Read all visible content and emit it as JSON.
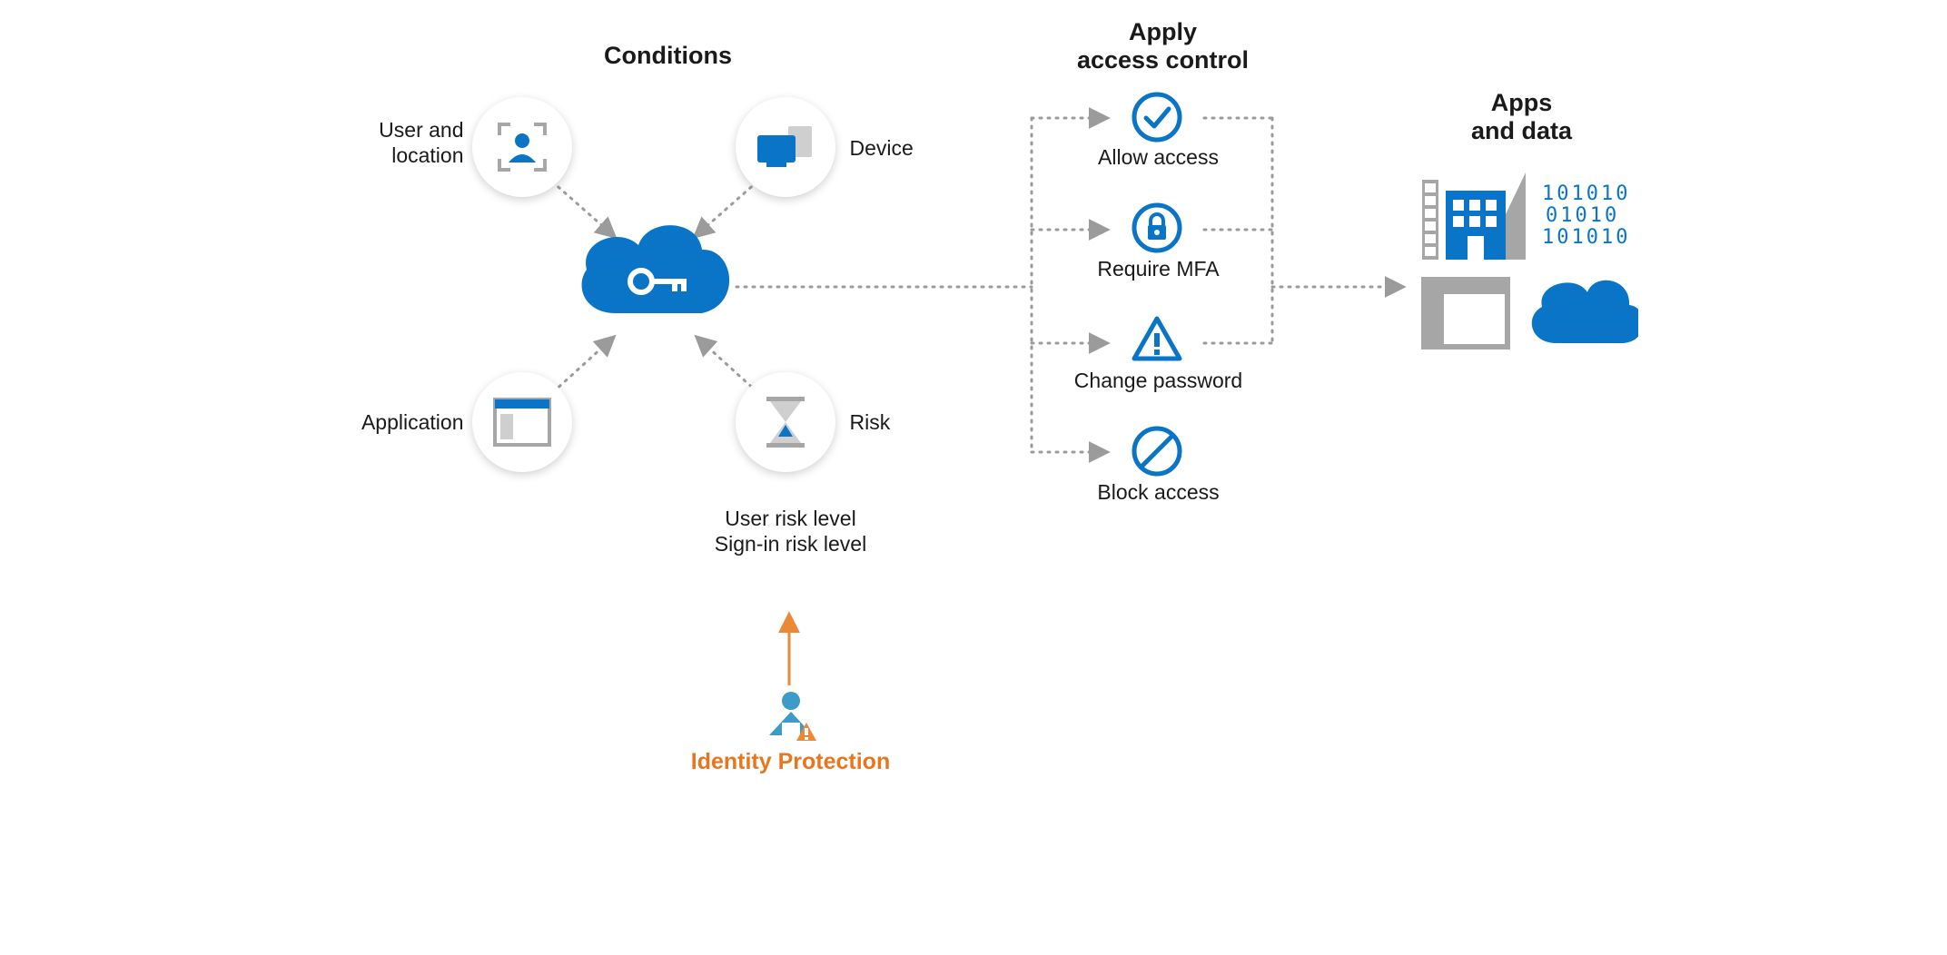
{
  "sections": {
    "conditions_title": "Conditions",
    "access_title_l1": "Apply",
    "access_title_l2": "access control",
    "apps_title_l1": "Apps",
    "apps_title_l2": "and data"
  },
  "conditions": {
    "user_location_l1": "User and",
    "user_location_l2": "location",
    "device": "Device",
    "application": "Application",
    "risk": "Risk",
    "risk_detail_l1": "User risk level",
    "risk_detail_l2": "Sign-in risk level",
    "identity_protection": "Identity Protection"
  },
  "access": {
    "allow": "Allow access",
    "mfa": "Require MFA",
    "change_pw": "Change password",
    "block": "Block access"
  },
  "colors": {
    "blue": "#0a75c6",
    "gray": "#a6a6a6",
    "orange": "#ec8936"
  }
}
